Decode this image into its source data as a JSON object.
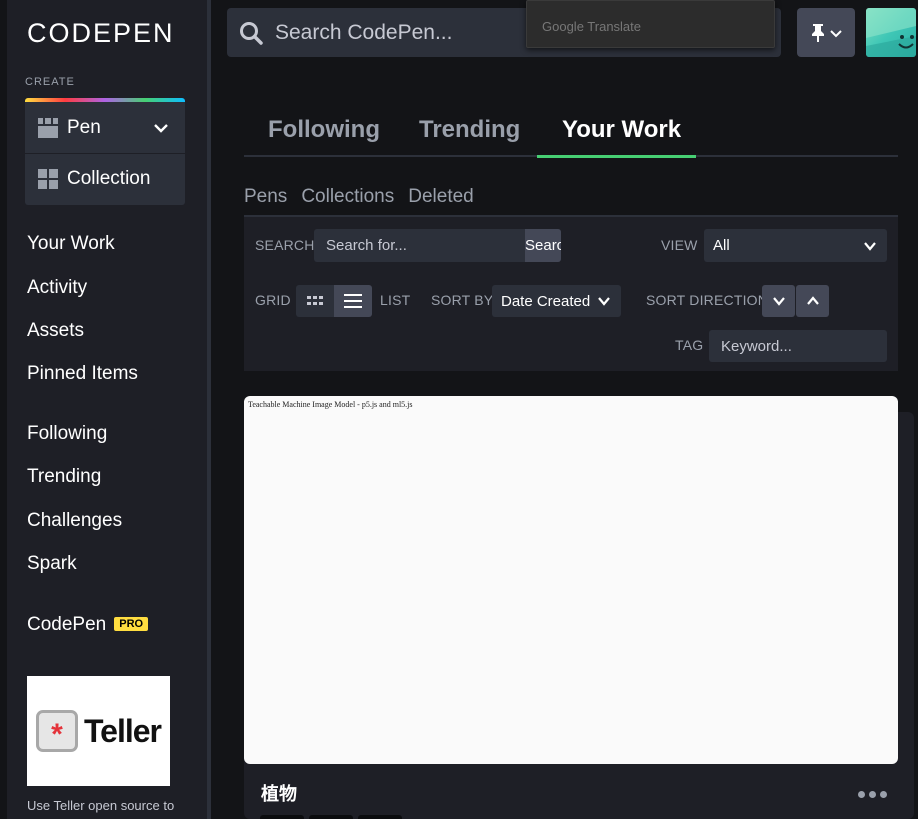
{
  "brand": {
    "logo_text": "CODEPEN"
  },
  "sidebar": {
    "create_label": "CREATE",
    "create_items": [
      {
        "label": "Pen",
        "icon": "pen-grid-icon"
      },
      {
        "label": "Collection",
        "icon": "collection-grid-icon"
      }
    ],
    "nav_primary": [
      "Your Work",
      "Activity",
      "Assets",
      "Pinned Items"
    ],
    "nav_secondary": [
      "Following",
      "Trending",
      "Challenges",
      "Spark"
    ],
    "pro": {
      "label": "CodePen",
      "badge": "PRO"
    },
    "ad": {
      "logo_text": "Teller",
      "text": "Use Teller open source to"
    }
  },
  "header": {
    "search_placeholder": "Search CodePen...",
    "translate_popup": "Google Translate"
  },
  "tabs": {
    "main": [
      "Following",
      "Trending",
      "Your Work"
    ],
    "active": "Your Work",
    "sub": [
      "Pens",
      "Collections",
      "Deleted"
    ]
  },
  "filters": {
    "search_label": "SEARCH",
    "search_placeholder": "Search for...",
    "search_button": "Search",
    "view_label": "VIEW",
    "view_value": "All",
    "grid_label": "GRID",
    "list_label": "LIST",
    "sort_by_label": "SORT BY",
    "sort_by_value": "Date Created",
    "sort_direction_label": "SORT DIRECTION",
    "tag_label": "TAG",
    "tag_placeholder": "Keyword..."
  },
  "pen_card": {
    "preview_text": "Teachable Machine Image Model - p5.js and ml5.js",
    "title": "植物"
  },
  "colors": {
    "accent_green": "#47cf73",
    "pro_yellow": "#ffdd40",
    "sidebar_bg": "#1e1f26",
    "page_bg": "#131417"
  }
}
